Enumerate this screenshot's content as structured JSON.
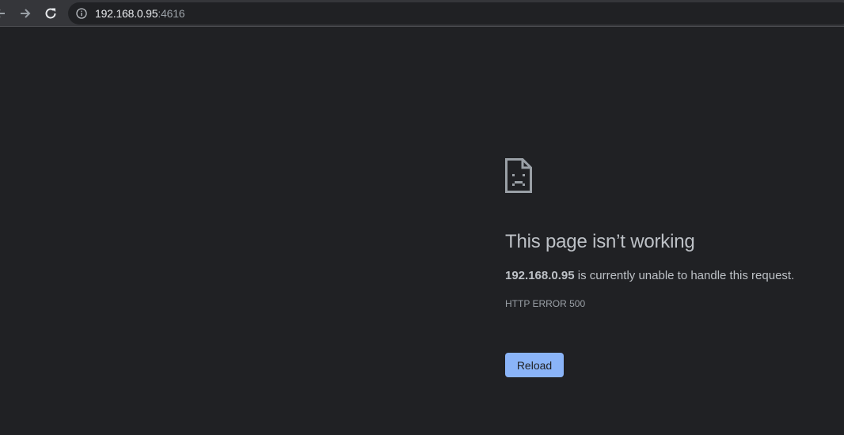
{
  "browser": {
    "url_host": "192.168.0.95",
    "url_port": ":4616",
    "icons": {
      "back": "arrow-left-icon",
      "forward": "arrow-right-icon",
      "reload": "reload-icon",
      "site_info": "info-icon"
    }
  },
  "error_page": {
    "icon": "sad-page-icon",
    "heading": "This page isn’t working",
    "host": "192.168.0.95",
    "message": " is currently unable to handle this request.",
    "error_code": "HTTP ERROR 500",
    "reload_label": "Reload"
  },
  "colors": {
    "background": "#202124",
    "toolbar": "#35363a",
    "text": "#bdc1c6",
    "button": "#8ab4f8"
  }
}
